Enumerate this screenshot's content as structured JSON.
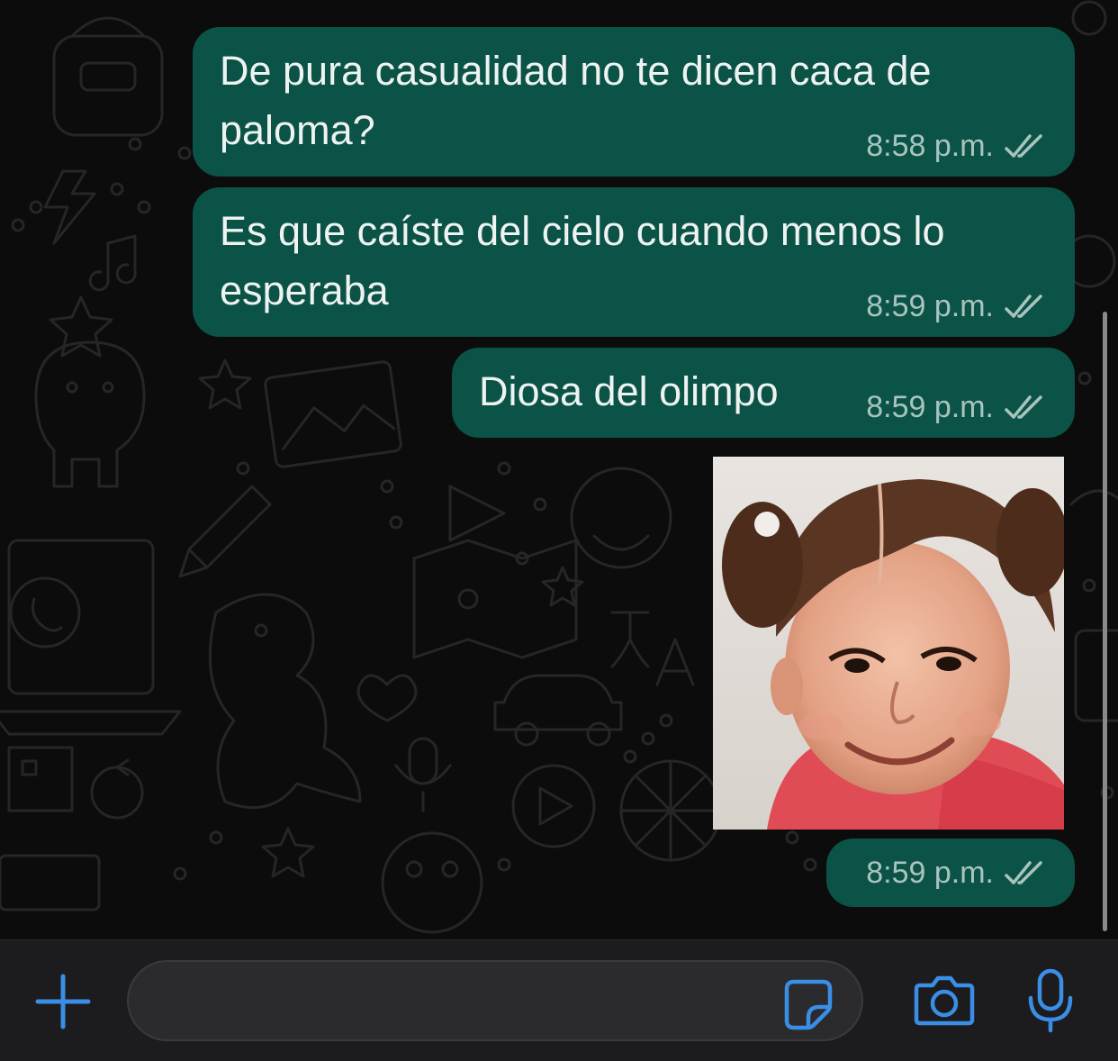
{
  "chat": {
    "messages": [
      {
        "type": "text",
        "lines": [
          "De pura casualidad no te dicen caca de",
          "paloma?"
        ],
        "time": "8:58 p.m.",
        "status": "read-double-check-icon"
      },
      {
        "type": "text",
        "lines": [
          "Es que caíste del cielo cuando menos lo",
          "esperaba"
        ],
        "time": "8:59 p.m.",
        "status": "read-double-check-icon"
      },
      {
        "type": "text",
        "lines": [
          "Diosa del olimpo"
        ],
        "time": "8:59 p.m.",
        "status": "read-double-check-icon"
      },
      {
        "type": "image",
        "time": "8:59 p.m.",
        "status": "read-double-check-icon"
      }
    ]
  },
  "input_bar": {
    "icons": [
      "plus-icon",
      "sticker-icon",
      "camera-icon",
      "microphone-icon"
    ],
    "accent_color": "#3a8ee6"
  },
  "colors": {
    "outgoing_bubble": "#0b5347",
    "background": "#0c0c0c",
    "input_bar": "#1c1c1e"
  }
}
